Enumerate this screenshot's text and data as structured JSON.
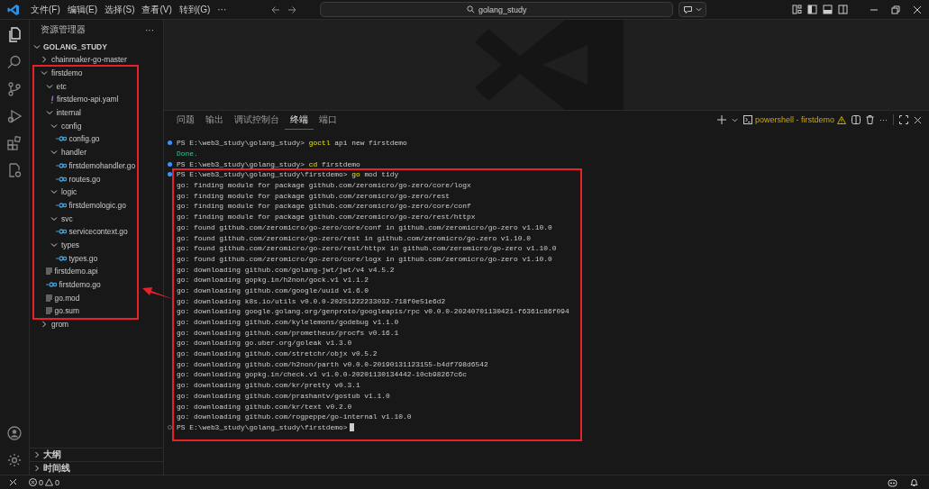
{
  "title_bar": {
    "menu": [
      "文件(F)",
      "编辑(E)",
      "选择(S)",
      "查看(V)",
      "转到(G)",
      "···"
    ],
    "search": {
      "value": "golang_study"
    }
  },
  "sidebar": {
    "title": "资源管理器",
    "more": "···",
    "section": {
      "label": "GOLANG_STUDY",
      "expanded": true
    },
    "tree": [
      {
        "kind": "folder",
        "label": "chainmaker-go-master",
        "expanded": false
      },
      {
        "kind": "folder",
        "label": "firstdemo",
        "expanded": true,
        "children": [
          {
            "kind": "folder",
            "label": "etc",
            "expanded": true,
            "children": [
              {
                "kind": "yaml",
                "label": "firstdemo-api.yaml"
              }
            ]
          },
          {
            "kind": "folder",
            "label": "internal",
            "expanded": true,
            "children": [
              {
                "kind": "folder",
                "label": "config",
                "expanded": true,
                "children": [
                  {
                    "kind": "go",
                    "label": "config.go"
                  }
                ]
              },
              {
                "kind": "folder",
                "label": "handler",
                "expanded": true,
                "children": [
                  {
                    "kind": "go",
                    "label": "firstdemohandler.go"
                  },
                  {
                    "kind": "go",
                    "label": "routes.go"
                  }
                ]
              },
              {
                "kind": "folder",
                "label": "logic",
                "expanded": true,
                "children": [
                  {
                    "kind": "go",
                    "label": "firstdemologic.go"
                  }
                ]
              },
              {
                "kind": "folder",
                "label": "svc",
                "expanded": true,
                "children": [
                  {
                    "kind": "go",
                    "label": "servicecontext.go"
                  }
                ]
              },
              {
                "kind": "folder",
                "label": "types",
                "expanded": true,
                "children": [
                  {
                    "kind": "go",
                    "label": "types.go"
                  }
                ]
              }
            ]
          },
          {
            "kind": "text",
            "label": "firstdemo.api"
          },
          {
            "kind": "go",
            "label": "firstdemo.go"
          },
          {
            "kind": "text",
            "label": "go.mod"
          },
          {
            "kind": "text",
            "label": "go.sum"
          }
        ]
      },
      {
        "kind": "folder",
        "label": "grom",
        "expanded": false
      }
    ],
    "bottom_sections": [
      {
        "label": "大纲",
        "expanded": false
      },
      {
        "label": "时间线",
        "expanded": false
      }
    ]
  },
  "panel": {
    "tabs": [
      {
        "label": "问题",
        "selected": false
      },
      {
        "label": "输出",
        "selected": false
      },
      {
        "label": "调试控制台",
        "selected": false
      },
      {
        "label": "终端",
        "selected": true
      },
      {
        "label": "端口",
        "selected": false
      }
    ],
    "terminal_name": "powershell - firstdemo",
    "more": "···",
    "terminal": [
      {
        "kind": "prompt",
        "done": true,
        "path": "PS E:\\web3_study\\golang_study>",
        "command": "goctl",
        "args": "api new firstdemo",
        "cursor": false
      },
      {
        "kind": "success",
        "text": "Done."
      },
      {
        "kind": "prompt",
        "done": true,
        "path": "PS E:\\web3_study\\golang_study>",
        "command": "cd",
        "args": "firstdemo",
        "cursor": false
      },
      {
        "kind": "prompt",
        "done": true,
        "path": "PS E:\\web3_study\\golang_study\\firstdemo>",
        "command": "go",
        "args": "mod tidy",
        "cursor": false
      },
      {
        "kind": "output",
        "text": "go: finding module for package github.com/zeromicro/go-zero/core/logx"
      },
      {
        "kind": "output",
        "text": "go: finding module for package github.com/zeromicro/go-zero/rest"
      },
      {
        "kind": "output",
        "text": "go: finding module for package github.com/zeromicro/go-zero/core/conf"
      },
      {
        "kind": "output",
        "text": "go: finding module for package github.com/zeromicro/go-zero/rest/httpx"
      },
      {
        "kind": "output",
        "text": "go: found github.com/zeromicro/go-zero/core/conf in github.com/zeromicro/go-zero v1.10.0"
      },
      {
        "kind": "output",
        "text": "go: found github.com/zeromicro/go-zero/rest in github.com/zeromicro/go-zero v1.10.0"
      },
      {
        "kind": "output",
        "text": "go: found github.com/zeromicro/go-zero/rest/httpx in github.com/zeromicro/go-zero v1.10.0"
      },
      {
        "kind": "output",
        "text": "go: found github.com/zeromicro/go-zero/core/logx in github.com/zeromicro/go-zero v1.10.0"
      },
      {
        "kind": "output",
        "text": "go: downloading github.com/golang-jwt/jwt/v4 v4.5.2"
      },
      {
        "kind": "output",
        "text": "go: downloading gopkg.in/h2non/gock.v1 v1.1.2"
      },
      {
        "kind": "output",
        "text": "go: downloading github.com/google/uuid v1.6.0"
      },
      {
        "kind": "output",
        "text": "go: downloading k8s.io/utils v0.0.0-20251222233032-718f0e51e6d2"
      },
      {
        "kind": "output",
        "text": "go: downloading google.golang.org/genproto/googleapis/rpc v0.0.0-20240701130421-f6361c86f094"
      },
      {
        "kind": "output",
        "text": "go: downloading github.com/kylelemons/godebug v1.1.0"
      },
      {
        "kind": "output",
        "text": "go: downloading github.com/prometheus/procfs v0.16.1"
      },
      {
        "kind": "output",
        "text": "go: downloading go.uber.org/goleak v1.3.0"
      },
      {
        "kind": "output",
        "text": "go: downloading github.com/stretchr/objx v0.5.2"
      },
      {
        "kind": "output",
        "text": "go: downloading github.com/h2non/parth v0.0.0-20190131123155-b4df798d6542"
      },
      {
        "kind": "output",
        "text": "go: downloading gopkg.in/check.v1 v1.0.0-20201130134442-10cb98267c6c"
      },
      {
        "kind": "output",
        "text": "go: downloading github.com/kr/pretty v0.3.1"
      },
      {
        "kind": "output",
        "text": "go: downloading github.com/prashantv/gostub v1.1.0"
      },
      {
        "kind": "output",
        "text": "go: downloading github.com/kr/text v0.2.0"
      },
      {
        "kind": "output",
        "text": "go: downloading github.com/rogpeppe/go-internal v1.10.0"
      },
      {
        "kind": "prompt",
        "done": false,
        "path": "PS E:\\web3_study\\golang_study\\firstdemo>",
        "cursor": true
      }
    ]
  },
  "status_bar": {
    "errors": "0",
    "warnings": "0"
  },
  "annotations": [
    {
      "kind": "box"
    },
    {
      "kind": "box"
    },
    {
      "kind": "arrow"
    }
  ]
}
